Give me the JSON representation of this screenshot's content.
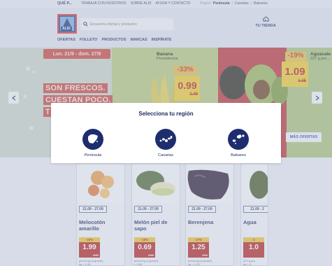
{
  "topbar": {
    "brand": "QUÉ P...",
    "links": [
      "TRABAJA CON NOSOTROS",
      "SOBRE ALDI",
      "AYUDA Y CONTACTO"
    ],
    "region_prefix": "Región",
    "regions": [
      "Península",
      "Canarias",
      "Baleares"
    ],
    "active_region": "Península"
  },
  "header": {
    "logo_text": "ALDI",
    "search_placeholder": "Encuentra ofertas y productos",
    "store_label": "TU TIENDA",
    "nav": [
      "OFERTAS",
      "FOLLETO",
      "PRODUCTOS",
      "MARCAS",
      "INSPÍRATE"
    ]
  },
  "hero": {
    "date_range": "Lun. 21/9 - dom. 27/9",
    "slogan": [
      "SON FRESCOS.",
      "CUESTAN POCO.",
      "T"
    ],
    "banana": {
      "name": "Banana",
      "origin": "Procedencia",
      "pct": "-33%",
      "price": "0.99",
      "old": "1.49"
    },
    "aguacate": {
      "name": "Aguacate",
      "weight": "227 g por...",
      "pct": "-19%",
      "price": "1.09",
      "old": "1.35"
    },
    "more_button": "MÁS OFERTAS"
  },
  "products": [
    {
      "date": "21.09 - 27.09",
      "name": "Melocotón amarillo",
      "discount": "-26%",
      "price": "1.99",
      "old": "2.69",
      "unit": "precio kg (a granel)\nkg = 1.99"
    },
    {
      "date": "21.09 - 27.09",
      "name": "Melón piel de sapo",
      "discount": "-18%",
      "price": "0.69",
      "old": "0.85",
      "unit": "precio kg (a granel)\n= 0.69"
    },
    {
      "date": "21.09 - 27.09",
      "name": "Berenjena",
      "discount": "-37%",
      "price": "1.25",
      "old": "1.99",
      "unit": "precio kg (a granel)\nkg = 1.25"
    },
    {
      "date": "21.09 - 2",
      "name": "Agua",
      "discount": "-1",
      "price": "1.0",
      "old": "",
      "unit": "227 g por\nkg = 4."
    }
  ],
  "modal": {
    "title": "Selecciona tu región",
    "regions": [
      "Península",
      "Canarias",
      "Baleares"
    ]
  },
  "colors": {
    "navy": "#1b2a5c",
    "aldi_blue": "#2c4a9a",
    "price_red": "#b32624",
    "promo_yellow": "#ecc834",
    "region_icon_bg": "#1e2d6e"
  }
}
